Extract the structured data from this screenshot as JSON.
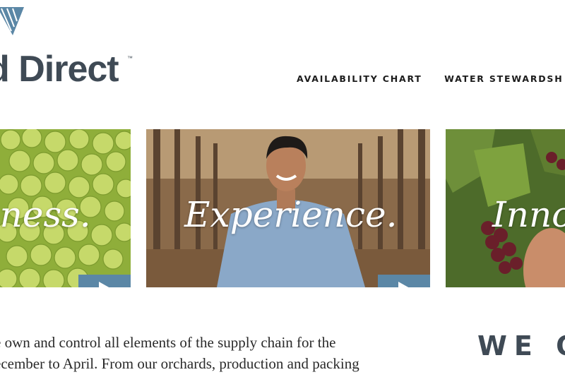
{
  "header": {
    "logo_text": "d Direct",
    "logo_tm": "™",
    "logo_color": "#3f4a55",
    "logo_mark_color": "#5b87a6"
  },
  "nav": {
    "items": [
      {
        "label": "AVAILABILITY CHART"
      },
      {
        "label": "WATER STEWARDSH"
      }
    ]
  },
  "tiles": [
    {
      "title": "...ness.",
      "icon": "play-icon",
      "theme": "green grapes"
    },
    {
      "title": "Experience.",
      "icon": "play-icon",
      "theme": "farmer in orchard"
    },
    {
      "title": "Inno",
      "icon": "play-icon",
      "theme": "red grapes on vine"
    }
  ],
  "intro": {
    "line1": "e own and control all elements of the supply chain for the",
    "line2": "ecember to April. From our orchards, production and packing"
  },
  "we_heading": "WE O",
  "colors": {
    "accent": "#5b87a6",
    "text": "#2a2a2a"
  }
}
